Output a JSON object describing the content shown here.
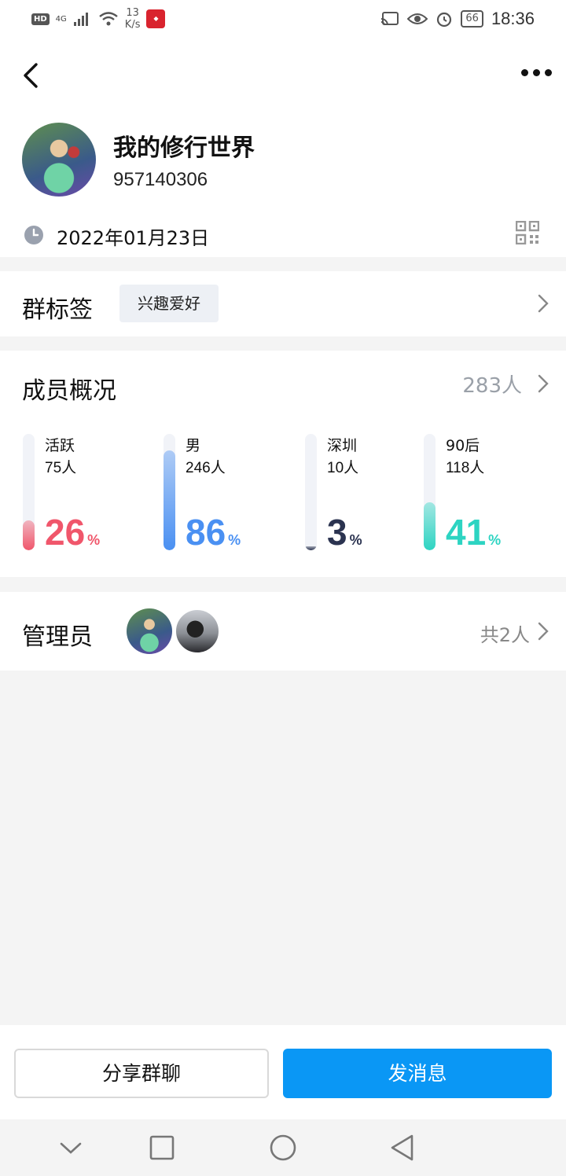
{
  "status_bar": {
    "hd": "HD",
    "signal": "4G",
    "speed_value": "13",
    "speed_unit": "K/s",
    "battery": "66",
    "time": "18:36"
  },
  "header": {
    "back_icon": "back-arrow-icon",
    "more_icon": "more-dots-icon"
  },
  "group": {
    "name": "我的修行世界",
    "id": "957140306",
    "created_date": "2022年01月23日"
  },
  "tags": {
    "title": "群标签",
    "chip": "兴趣爱好"
  },
  "members": {
    "title": "成员概况",
    "count": "283人",
    "stats": [
      {
        "label": "活跃",
        "count": "75人",
        "percent": "26",
        "unit": "%",
        "fraction": 0.26,
        "color": "#f0566b",
        "track": "#f1f3f8"
      },
      {
        "label": "男",
        "count": "246人",
        "percent": "86",
        "unit": "%",
        "fraction": 0.86,
        "color": "#4a90f2",
        "track": "#f1f3f8"
      },
      {
        "label": "深圳",
        "count": "10人",
        "percent": "3",
        "unit": "%",
        "fraction": 0.03,
        "color": "#2b3350",
        "track": "#f1f3f8"
      },
      {
        "label": "90后",
        "count": "118人",
        "percent": "41",
        "unit": "%",
        "fraction": 0.41,
        "color": "#2dd4c2",
        "track": "#f1f3f8"
      }
    ]
  },
  "admins": {
    "title": "管理员",
    "total": "共2人"
  },
  "actions": {
    "share": "分享群聊",
    "send": "发消息"
  },
  "colors": {
    "accent": "#0a97f5",
    "background": "#f4f4f4"
  }
}
